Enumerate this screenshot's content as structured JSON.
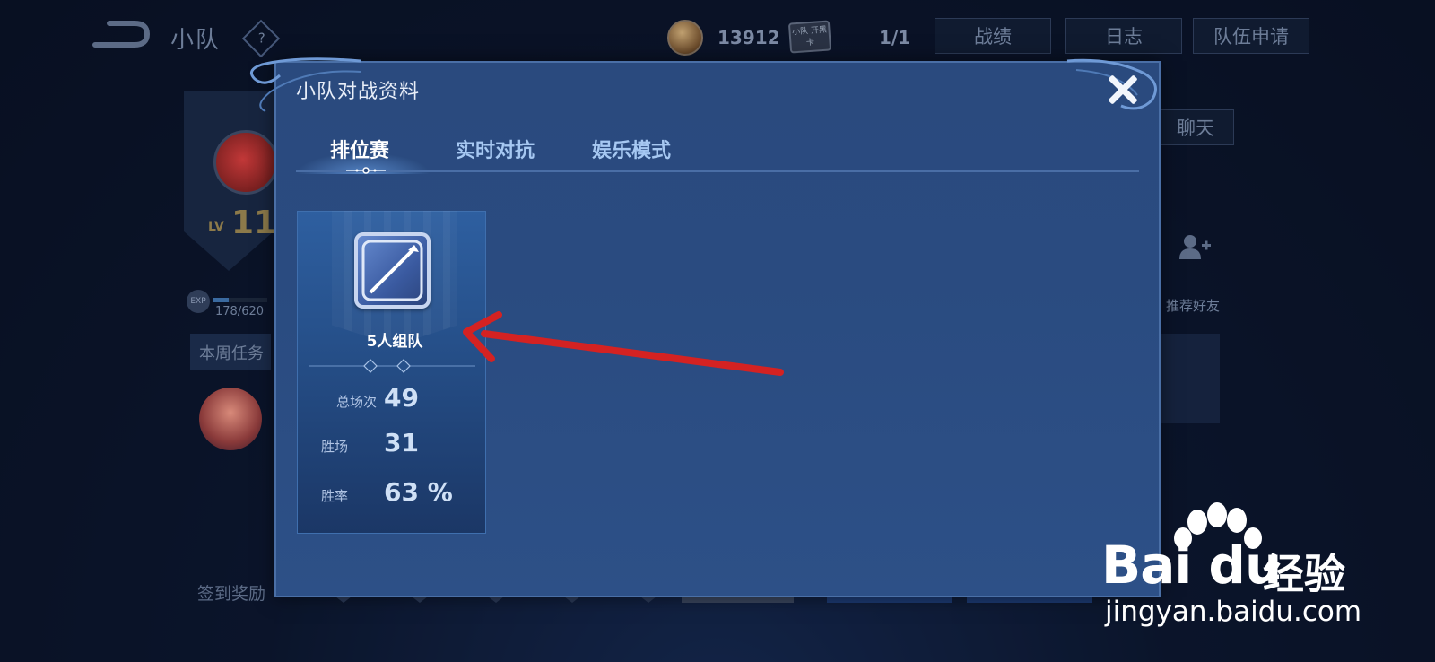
{
  "background": {
    "title": "小队",
    "help_glyph": "?",
    "coins": "13912",
    "card_text": "小队 开黑卡",
    "member_count": "1/1",
    "buttons": {
      "record": "战绩",
      "log": "日志",
      "apply": "队伍申请",
      "chat": "聊天"
    },
    "level_label": "LV",
    "level_value": "11",
    "exp_icon_text": "EXP",
    "exp_text": "178/620",
    "exp_progress": 0.287,
    "weekly_task": "本周任务",
    "signin_reward": "签到奖励",
    "recommend_friends": "推荐好友"
  },
  "dialog": {
    "title": "小队对战资料",
    "tabs": [
      {
        "label": "排位赛",
        "active": true
      },
      {
        "label": "实时对抗",
        "active": false
      },
      {
        "label": "娱乐模式",
        "active": false
      }
    ],
    "card": {
      "mode_label": "5人组队",
      "stats": {
        "total_label": "总场次",
        "total_value": "49",
        "win_label": "胜场",
        "win_value": "31",
        "rate_label": "胜率",
        "rate_value": "63 %"
      }
    }
  },
  "watermark": {
    "brand": "Bai du",
    "product": "经验",
    "url": "jingyan.baidu.com"
  },
  "colors": {
    "dialog_bg": "#2a4b80",
    "card_bg": "#26508a",
    "annotation_arrow": "#d42222",
    "tab_inactive": "#a6c8f2"
  }
}
